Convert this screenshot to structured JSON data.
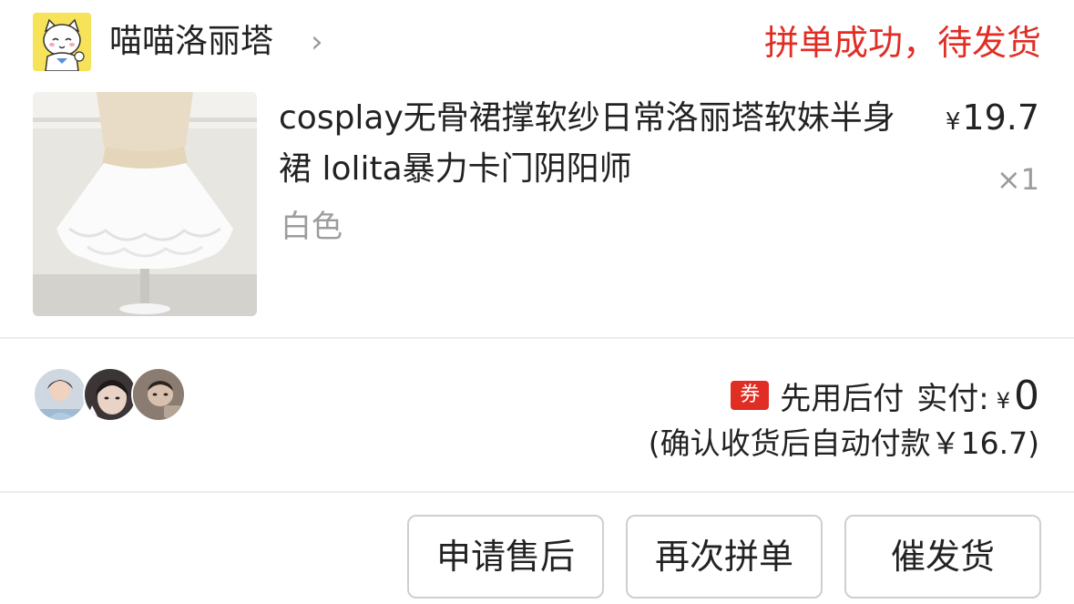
{
  "shop": {
    "name": "喵喵洛丽塔",
    "chevron": "›",
    "status": "拼单成功，待发货"
  },
  "product": {
    "title": "cosplay无骨裙撑软纱日常洛丽塔软妹半身裙 lolita暴力卡门阴阳师",
    "variant": "白色",
    "price_currency": "¥",
    "price": "19.7",
    "quantity": "×1"
  },
  "group": {
    "member_count": 3
  },
  "payment": {
    "coupon_badge": "券",
    "label": "先用后付",
    "paid_label": "实付:",
    "currency": "¥",
    "paid_amount": "0",
    "auto_pay_note": "(确认收货后自动付款￥16.7)"
  },
  "actions": {
    "after_sale": "申请售后",
    "regroup": "再次拼单",
    "urge_ship": "催发货"
  },
  "colors": {
    "accent_red": "#e02e24",
    "muted_gray": "#9c9c9c",
    "divider": "#ececec"
  }
}
